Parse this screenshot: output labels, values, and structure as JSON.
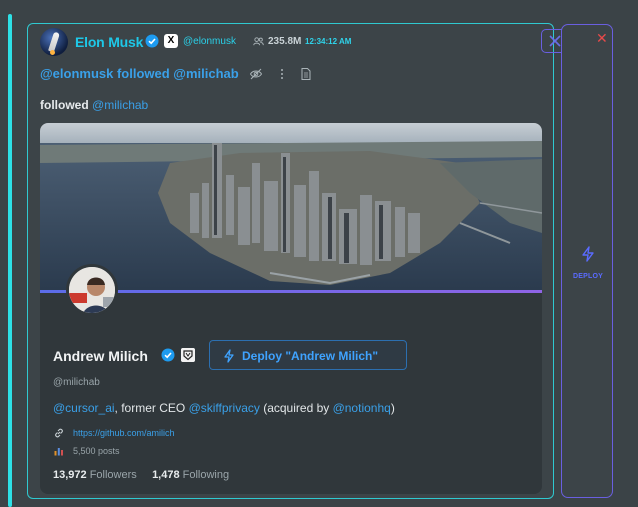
{
  "post": {
    "author_name": "Elon Musk",
    "author_handle": "@elonmusk",
    "follower_count": "235.8M",
    "time": "12:34:12 AM",
    "x_label": "X"
  },
  "action": {
    "text": "@elonmusk followed @milichab",
    "followed_prefix": "followed",
    "followed_mention": "@milichab"
  },
  "profile": {
    "name": "Andrew Milich",
    "handle": "@milichab",
    "deploy_label": "Deploy \"Andrew Milich\"",
    "bio": {
      "m1": "@cursor_ai",
      "t1": ", former CEO ",
      "m2": "@skiffprivacy",
      "t2": " (acquired by ",
      "m3": "@notionhq",
      "t3": ")"
    },
    "link": "https://github.com/amilich",
    "posts": "5,500 posts",
    "followers_count": "13,972",
    "followers_label": " Followers",
    "following_count": "1,478",
    "following_label": " Following"
  },
  "side": {
    "deploy_label": "DEPLOY",
    "close_glyph": "✕"
  },
  "colors": {
    "accent_cyan": "#2de0e6",
    "link_blue": "#3aa0e8",
    "deploy_purple": "#6a5fe0",
    "close_red": "#e84a4a"
  }
}
